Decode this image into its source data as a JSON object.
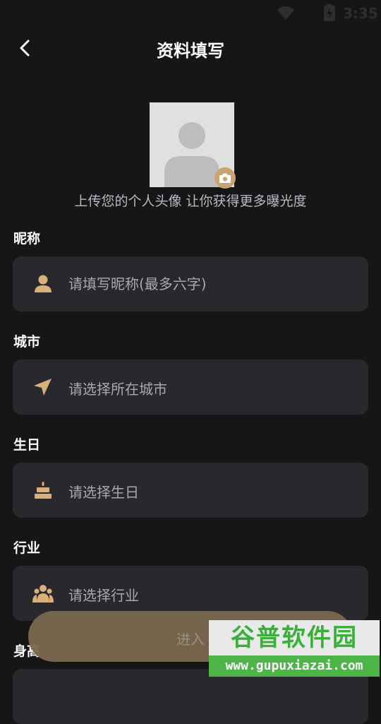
{
  "status_bar": {
    "time": "3:35"
  },
  "header": {
    "title": "资料填写"
  },
  "avatar": {
    "tip": "上传您的个人头像 让你获得更多曝光度"
  },
  "form": {
    "nickname": {
      "label": "昵称",
      "placeholder": "请填写昵称(最多六字)",
      "icon": "person-icon"
    },
    "city": {
      "label": "城市",
      "placeholder": "请选择所在城市",
      "icon": "location-arrow-icon"
    },
    "birthday": {
      "label": "生日",
      "placeholder": "请选择生日",
      "icon": "cake-icon"
    },
    "industry": {
      "label": "行业",
      "placeholder": "请选择行业",
      "icon": "group-icon"
    },
    "height": {
      "label": "身高"
    }
  },
  "enter_button": {
    "label": "进入"
  },
  "watermark": {
    "title": "谷普软件园",
    "url": "www.gupuxiazai.com"
  },
  "colors": {
    "accent": "#c9a46f",
    "background": "#161616",
    "field": "#28282d"
  }
}
